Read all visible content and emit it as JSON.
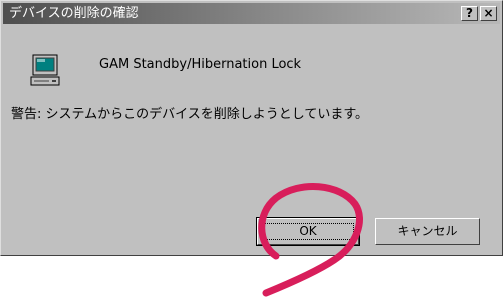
{
  "dialog": {
    "title": "デバイスの削除の確認",
    "help_button": "?",
    "close_button": "×",
    "device_name": "GAM Standby/Hibernation Lock",
    "warning_text": "警告: システムからこのデバイスを削除しようとしています。",
    "ok_label": "OK",
    "cancel_label": "キャンセル"
  },
  "annotation": {
    "color": "#d81e5b"
  }
}
